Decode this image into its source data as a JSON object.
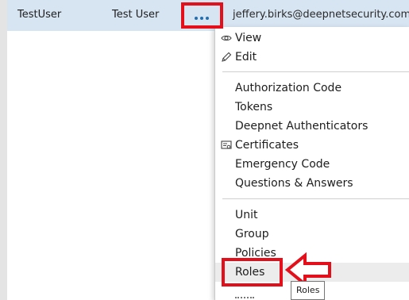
{
  "user_row": {
    "username": "TestUser",
    "name": "Test User",
    "email": "jeffery.birks@deepnetsecurity.com"
  },
  "actions_menu": {
    "group1": [
      {
        "label": "View",
        "icon": "eye-icon"
      },
      {
        "label": "Edit",
        "icon": "pencil-icon"
      }
    ],
    "group2": [
      {
        "label": "Authorization Code"
      },
      {
        "label": "Tokens"
      },
      {
        "label": "Deepnet Authenticators"
      },
      {
        "label": "Certificates",
        "icon": "certificate-icon"
      },
      {
        "label": "Emergency Code"
      },
      {
        "label": "Questions & Answers"
      }
    ],
    "group3": [
      {
        "label": "Unit"
      },
      {
        "label": "Group"
      },
      {
        "label": "Policies"
      },
      {
        "label": "Roles"
      }
    ]
  },
  "tooltip": "Roles",
  "colors": {
    "row_selected": "#d7e4f2",
    "annotation_red": "#e3101b",
    "dots_blue": "#1f6fb3",
    "hover": "#ececec"
  }
}
